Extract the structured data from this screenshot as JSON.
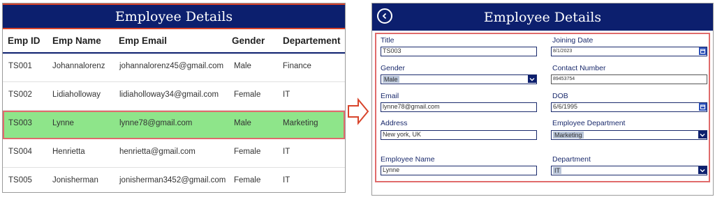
{
  "left": {
    "title": "Employee Details",
    "columns": [
      "Emp ID",
      "Emp Name",
      "Emp Email",
      "Gender",
      "Departement"
    ],
    "rows": [
      {
        "id": "TS001",
        "name": "Johannalorenz",
        "email": "johannalorenz45@gmail.com",
        "gender": "Male",
        "dept": "Finance"
      },
      {
        "id": "TS002",
        "name": "Lidiaholloway",
        "email": "lidiaholloway34@gmail.com",
        "gender": "Female",
        "dept": "IT"
      },
      {
        "id": "TS003",
        "name": "Lynne",
        "email": "lynne78@gmail.com",
        "gender": "Male",
        "dept": "Marketing"
      },
      {
        "id": "TS004",
        "name": "Henrietta",
        "email": "henrietta@gmail.com",
        "gender": "Female",
        "dept": "IT"
      },
      {
        "id": "TS005",
        "name": "Jonisherman",
        "email": "jonisherman3452@gmail.com",
        "gender": "Female",
        "dept": "IT"
      }
    ],
    "selected_row": 2
  },
  "right": {
    "title": "Employee Details",
    "fields": {
      "title": {
        "label": "Title",
        "value": "TS003"
      },
      "joining_date": {
        "label": "Joining Date",
        "value": "8/1/2023"
      },
      "gender": {
        "label": "Gender",
        "value": "Male"
      },
      "contact": {
        "label": "Contact Number",
        "value": "89453754"
      },
      "email": {
        "label": "Email",
        "value": "lynne78@gmail.com"
      },
      "dob": {
        "label": "DOB",
        "value": "6/6/1995"
      },
      "address": {
        "label": "Address",
        "value": "New york, UK"
      },
      "emp_dept": {
        "label": "Employee Department",
        "value": "Marketing"
      },
      "emp_name": {
        "label": "Employee Name",
        "value": "Lynne"
      },
      "department": {
        "label": "Department",
        "value": "IT"
      }
    }
  },
  "colors": {
    "header_bg": "#0c1f6e",
    "selected_row": "#8ee58a",
    "highlight_border": "#e06b6b"
  },
  "icons": [
    "back-icon",
    "chevron-down-icon",
    "calendar-icon",
    "arrow-right-icon"
  ]
}
